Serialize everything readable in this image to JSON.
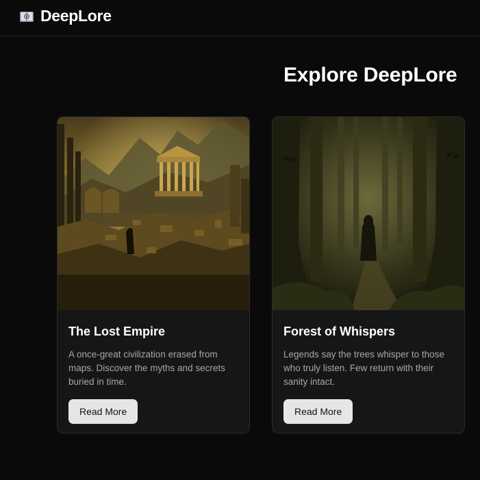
{
  "header": {
    "brand_icon": "open-book-icon",
    "brand_name": "DeepLore"
  },
  "main": {
    "title": "Explore DeepLore",
    "cards": [
      {
        "image": "ancient-ruins-temple-illustration",
        "title": "The Lost Empire",
        "description": "A once-great civilization erased from maps. Discover the myths and secrets buried in time.",
        "button_label": "Read More"
      },
      {
        "image": "dark-forest-cloaked-figure-illustration",
        "title": "Forest of Whispers",
        "description": "Legends say the trees whisper to those who truly listen. Few return with their sanity intact.",
        "button_label": "Read More"
      }
    ]
  },
  "colors": {
    "background": "#0a0a0a",
    "card_background": "#161616",
    "button_background": "#e6e6e6",
    "body_text": "#a8a8a8"
  }
}
